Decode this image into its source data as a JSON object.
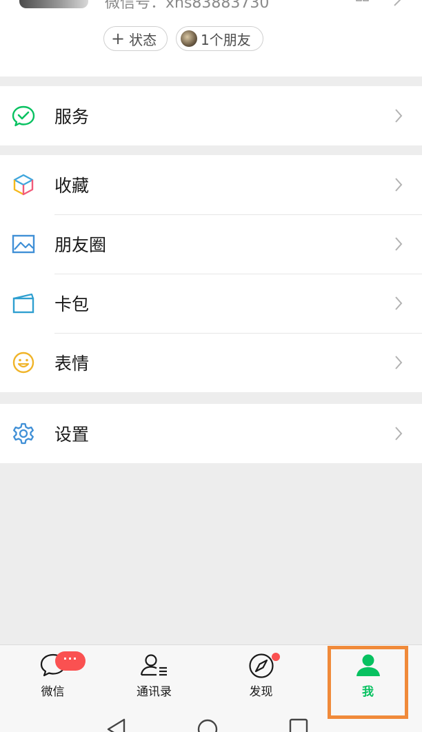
{
  "profile": {
    "wechat_id": "微信号：xhs83883730",
    "status_chip": "状态",
    "friends_chip": "1个朋友"
  },
  "menu": {
    "service": "服务",
    "favorites": "收藏",
    "moments": "朋友圈",
    "cards": "卡包",
    "stickers": "表情",
    "settings": "设置"
  },
  "tabbar": {
    "chats": "微信",
    "chats_badge": "···",
    "contacts": "通讯录",
    "discover": "发现",
    "me": "我",
    "active_tab": "me"
  },
  "colors": {
    "accent": "#07c160",
    "badge": "#fa5151",
    "highlight": "#f08a3a"
  }
}
